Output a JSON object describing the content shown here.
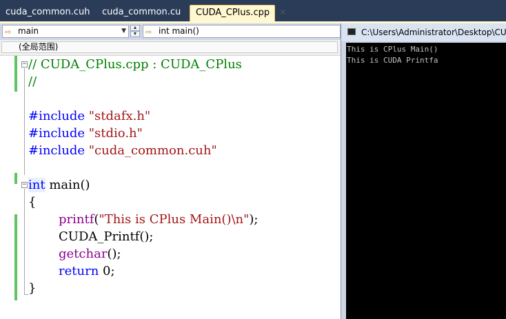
{
  "tabs": [
    {
      "label": "cuda_common.cuh",
      "active": false
    },
    {
      "label": "cuda_common.cu",
      "active": false
    },
    {
      "label": "CUDA_CPlus.cpp",
      "active": true
    }
  ],
  "tab_close_glyph": "✕",
  "nav": {
    "left_combo": "main",
    "right_combo": "int main()"
  },
  "scope": "(全局范围)",
  "code": {
    "line1": "// CUDA_CPlus.cpp : CUDA_CPlus",
    "line2": "//",
    "include1_kw": "#include",
    "include1_str": "\"stdafx.h\"",
    "include2_kw": "#include",
    "include2_str": "\"stdio.h\"",
    "include3_kw": "#include",
    "include3_str": "\"cuda_common.cuh\"",
    "main_kw": "int",
    "main_rest": " main()",
    "open_brace": "{",
    "printf_fn": "printf",
    "printf_open": "(",
    "printf_str": "\"This is CPlus Main()\\n\"",
    "printf_close": ");",
    "cuda_printf": "CUDA_Printf();",
    "getchar_fn": "getchar",
    "getchar_rest": "();",
    "return_kw": "return",
    "return_rest": " 0;",
    "close_brace": "}"
  },
  "console": {
    "title": "C:\\Users\\Administrator\\Desktop\\CUDA_CPlus",
    "lines": [
      "This is CPlus Main()",
      "This is CUDA Printfa"
    ]
  },
  "icons": {
    "nav_arrow": "⇨",
    "console_icon": "console-window-icon"
  },
  "colors": {
    "tabstrip": "#2b3c59",
    "active_tab": "#fff8d0",
    "comment": "#008000",
    "keyword": "#0000ff",
    "string": "#a31515",
    "function": "#8b008b",
    "change_bar": "#5fc35f",
    "console_bg": "#000000"
  }
}
